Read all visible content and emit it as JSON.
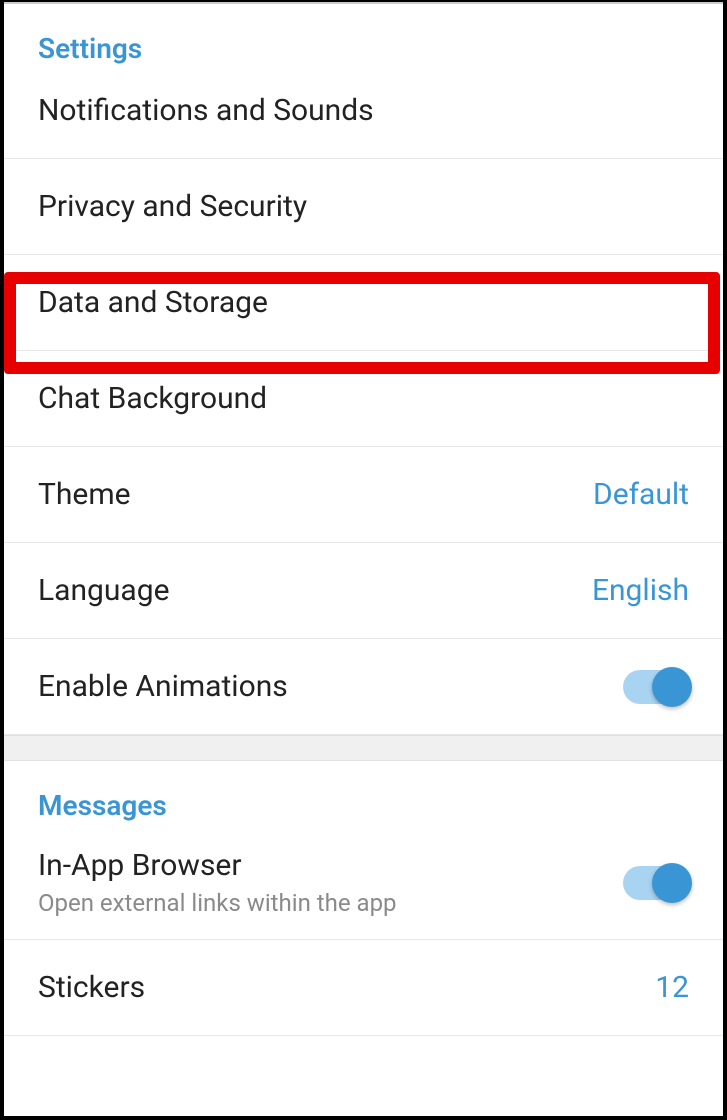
{
  "settings": {
    "header": "Settings",
    "items": {
      "notifications": "Notifications and Sounds",
      "privacy": "Privacy and Security",
      "data_storage": "Data and Storage",
      "chat_background": "Chat Background",
      "theme": {
        "label": "Theme",
        "value": "Default"
      },
      "language": {
        "label": "Language",
        "value": "English"
      },
      "animations": {
        "label": "Enable Animations",
        "enabled": true
      }
    }
  },
  "messages": {
    "header": "Messages",
    "items": {
      "in_app_browser": {
        "label": "In-App Browser",
        "sublabel": "Open external links within the app",
        "enabled": true
      },
      "stickers": {
        "label": "Stickers",
        "value": "12"
      }
    }
  }
}
